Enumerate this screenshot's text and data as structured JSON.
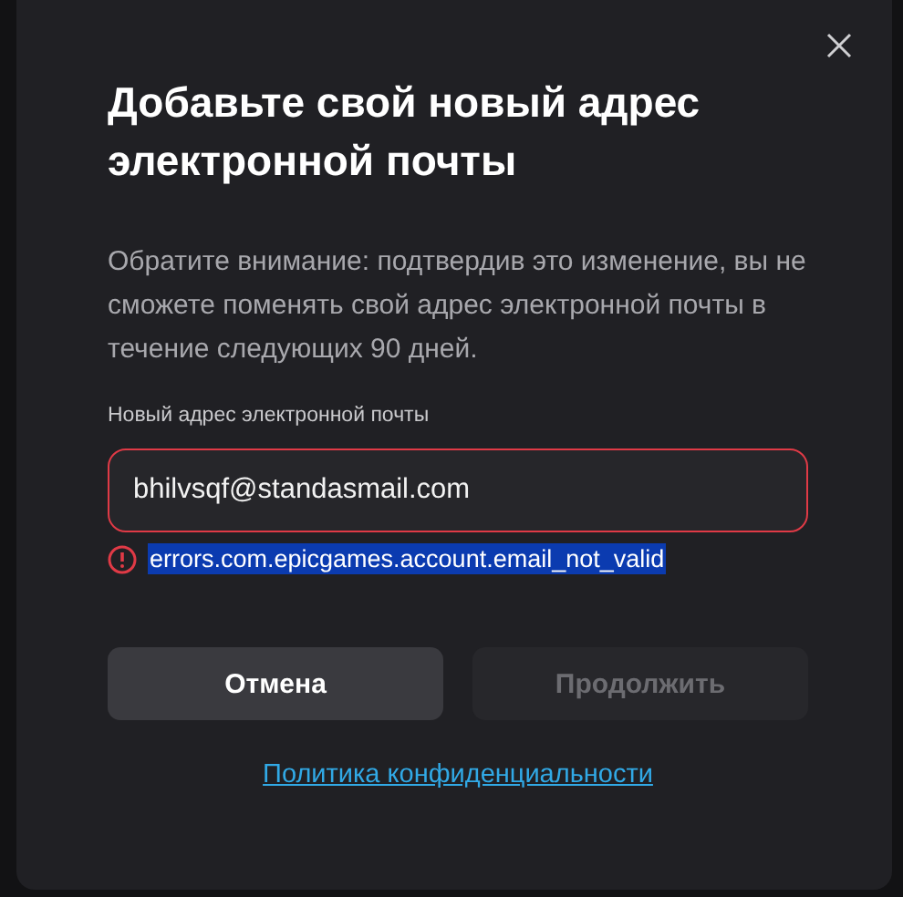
{
  "dialog": {
    "title": "Добавьте свой новый адрес электронной почты",
    "notice": "Обратите внимание: подтвердив это изменение, вы не сможете поменять свой адрес электронной почты в течение следующих 90 дней.",
    "field": {
      "label": "Новый адрес электронной почты",
      "value": "bhilvsqf@standasmail.com",
      "invalid": true
    },
    "error": {
      "text": "errors.com.epicgames.account.email_not_valid",
      "highlighted": true
    },
    "buttons": [
      {
        "label": "Отмена",
        "disabled": false
      },
      {
        "label": "Продолжить",
        "disabled": true
      }
    ],
    "link": "Политика конфиденциальности"
  }
}
